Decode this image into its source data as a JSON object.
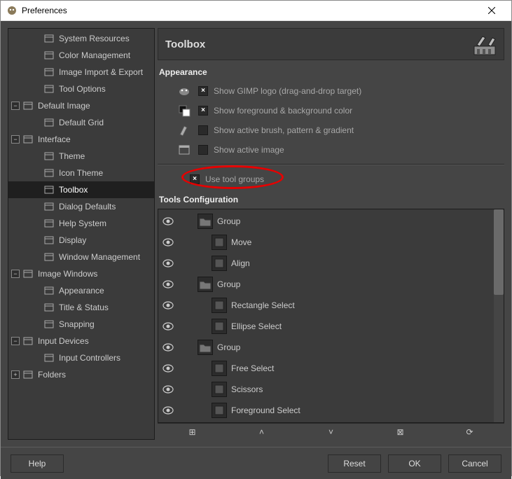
{
  "window": {
    "title": "Preferences"
  },
  "sidebar": {
    "items": [
      {
        "label": "System Resources",
        "depth": 1,
        "toggle": ""
      },
      {
        "label": "Color Management",
        "depth": 1,
        "toggle": ""
      },
      {
        "label": "Image Import & Export",
        "depth": 1,
        "toggle": ""
      },
      {
        "label": "Tool Options",
        "depth": 1,
        "toggle": ""
      },
      {
        "label": "Default Image",
        "depth": 0,
        "toggle": "−"
      },
      {
        "label": "Default Grid",
        "depth": 1,
        "toggle": ""
      },
      {
        "label": "Interface",
        "depth": 0,
        "toggle": "−"
      },
      {
        "label": "Theme",
        "depth": 1,
        "toggle": ""
      },
      {
        "label": "Icon Theme",
        "depth": 1,
        "toggle": ""
      },
      {
        "label": "Toolbox",
        "depth": 1,
        "toggle": "",
        "selected": true
      },
      {
        "label": "Dialog Defaults",
        "depth": 1,
        "toggle": ""
      },
      {
        "label": "Help System",
        "depth": 1,
        "toggle": ""
      },
      {
        "label": "Display",
        "depth": 1,
        "toggle": ""
      },
      {
        "label": "Window Management",
        "depth": 1,
        "toggle": ""
      },
      {
        "label": "Image Windows",
        "depth": 0,
        "toggle": "−"
      },
      {
        "label": "Appearance",
        "depth": 1,
        "toggle": ""
      },
      {
        "label": "Title & Status",
        "depth": 1,
        "toggle": ""
      },
      {
        "label": "Snapping",
        "depth": 1,
        "toggle": ""
      },
      {
        "label": "Input Devices",
        "depth": 0,
        "toggle": "−"
      },
      {
        "label": "Input Controllers",
        "depth": 1,
        "toggle": ""
      },
      {
        "label": "Folders",
        "depth": 0,
        "toggle": "+"
      }
    ]
  },
  "panel": {
    "title": "Toolbox",
    "appearance_title": "Appearance",
    "options": [
      {
        "label": "Show GIMP logo (drag-and-drop target)",
        "checked": true
      },
      {
        "label": "Show foreground & background color",
        "checked": true
      },
      {
        "label": "Show active brush, pattern & gradient",
        "checked": false
      },
      {
        "label": "Show active image",
        "checked": false
      }
    ],
    "use_tool_groups": {
      "label": "Use tool groups",
      "checked": true
    },
    "tools_title": "Tools Configuration",
    "tools": [
      {
        "label": "Group",
        "depth": 0,
        "kind": "group"
      },
      {
        "label": "Move",
        "depth": 1,
        "kind": "tool"
      },
      {
        "label": "Align",
        "depth": 1,
        "kind": "tool"
      },
      {
        "label": "Group",
        "depth": 0,
        "kind": "group"
      },
      {
        "label": "Rectangle Select",
        "depth": 1,
        "kind": "tool"
      },
      {
        "label": "Ellipse Select",
        "depth": 1,
        "kind": "tool"
      },
      {
        "label": "Group",
        "depth": 0,
        "kind": "group"
      },
      {
        "label": "Free Select",
        "depth": 1,
        "kind": "tool"
      },
      {
        "label": "Scissors",
        "depth": 1,
        "kind": "tool"
      },
      {
        "label": "Foreground Select",
        "depth": 1,
        "kind": "tool"
      }
    ],
    "toolbar": {
      "new": "⊞",
      "up": "˄",
      "down": "˅",
      "delete": "⊠",
      "reset": "⟳"
    }
  },
  "footer": {
    "help": "Help",
    "reset": "Reset",
    "ok": "OK",
    "cancel": "Cancel"
  }
}
